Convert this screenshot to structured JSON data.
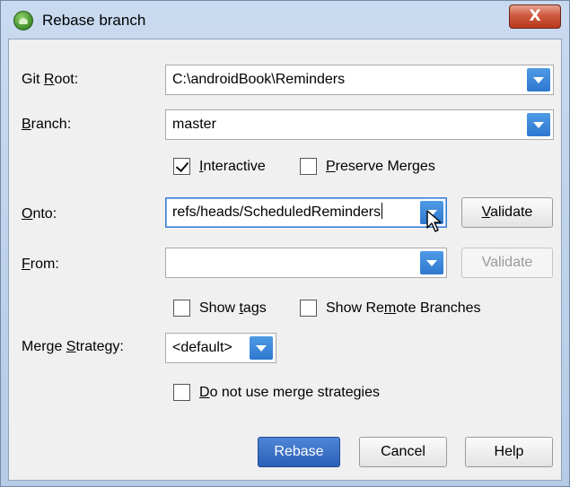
{
  "window": {
    "title": "Rebase branch",
    "close_glyph": "X"
  },
  "form": {
    "git_root": {
      "label_pre": "Git ",
      "label_mnemonic": "R",
      "label_post": "oot:",
      "value": "C:\\androidBook\\Reminders"
    },
    "branch": {
      "label_pre": "",
      "label_mnemonic": "B",
      "label_post": "ranch:",
      "value": "master"
    },
    "interactive": {
      "label_pre": "",
      "label_mnemonic": "I",
      "label_post": "nteractive",
      "checked": true
    },
    "preserve_merges": {
      "label_pre": "",
      "label_mnemonic": "P",
      "label_post": "reserve Merges",
      "checked": false
    },
    "onto": {
      "label_pre": "",
      "label_mnemonic": "O",
      "label_post": "nto:",
      "value": "refs/heads/ScheduledReminders"
    },
    "onto_validate": {
      "label_pre": "",
      "label_mnemonic": "V",
      "label_post": "alidate"
    },
    "from": {
      "label_pre": "",
      "label_mnemonic": "F",
      "label_post": "rom:",
      "value": ""
    },
    "from_validate": {
      "label": "Validate"
    },
    "show_tags": {
      "label_pre": "Show ",
      "label_mnemonic": "t",
      "label_post": "ags",
      "checked": false
    },
    "show_remote": {
      "label_pre": "Show Re",
      "label_mnemonic": "m",
      "label_post": "ote Branches",
      "checked": false
    },
    "merge_strategy": {
      "label_pre": "Merge ",
      "label_mnemonic": "S",
      "label_post": "trategy:",
      "value": "<default>"
    },
    "no_merge_strategies": {
      "label_pre": "",
      "label_mnemonic": "D",
      "label_post": "o not use merge strategies",
      "checked": false
    }
  },
  "footer": {
    "rebase": "Rebase",
    "cancel": "Cancel",
    "help": "Help"
  },
  "colors": {
    "accent": "#2d77cf",
    "primary_button": "#2c5fb8",
    "close_button": "#c8452a"
  }
}
